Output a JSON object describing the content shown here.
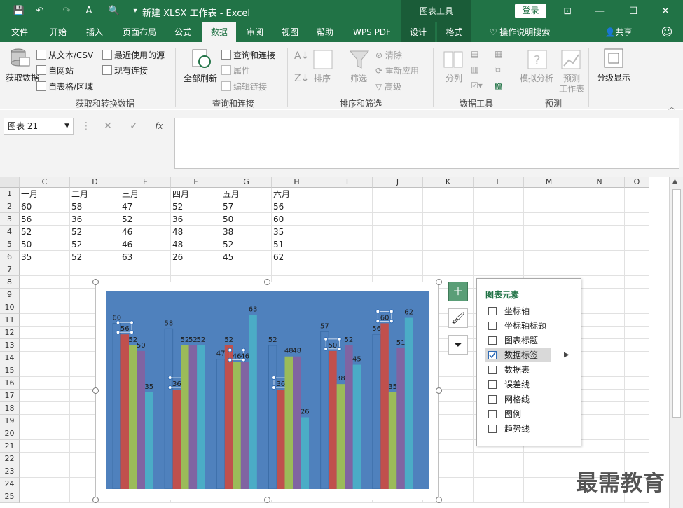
{
  "titlebar": {
    "title": "新建 XLSX 工作表 - Excel",
    "context_tab_group": "图表工具",
    "login_label": "登录"
  },
  "tabs": [
    "文件",
    "开始",
    "插入",
    "页面布局",
    "公式",
    "数据",
    "审阅",
    "视图",
    "帮助",
    "WPS PDF",
    "设计",
    "格式"
  ],
  "active_tab": "数据",
  "tell_me": "操作说明搜索",
  "share": "共享",
  "ribbon": {
    "get_data_label": "获取数据",
    "from_text_csv": "从文本/CSV",
    "from_web": "自网站",
    "from_table": "自表格/区域",
    "recent_sources": "最近使用的源",
    "existing_connections": "现有连接",
    "group_get_transform": "获取和转换数据",
    "refresh_all": "全部刷新",
    "queries_connections": "查询和连接",
    "properties": "属性",
    "edit_links": "编辑链接",
    "group_queries": "查询和连接",
    "sort": "排序",
    "filter": "筛选",
    "clear": "清除",
    "reapply": "重新应用",
    "advanced": "高级",
    "group_sort_filter": "排序和筛选",
    "text_to_columns": "分列",
    "group_data_tools": "数据工具",
    "what_if": "模拟分析",
    "forecast_sheet_line1": "预测",
    "forecast_sheet_line2": "工作表",
    "group_forecast": "预测",
    "outline": "分级显示"
  },
  "formula_bar": {
    "name_box": "图表 21",
    "fx": "fx",
    "content": ""
  },
  "columns": [
    "C",
    "D",
    "E",
    "F",
    "G",
    "H",
    "I",
    "J",
    "K",
    "L",
    "M",
    "N",
    "O"
  ],
  "rows": [
    "1",
    "2",
    "3",
    "4",
    "5",
    "6",
    "7",
    "8",
    "9",
    "10",
    "11",
    "12",
    "13",
    "14",
    "15",
    "16",
    "17",
    "18",
    "19",
    "20",
    "21",
    "22",
    "23",
    "24",
    "25"
  ],
  "table": [
    [
      "一月",
      "二月",
      "三月",
      "四月",
      "五月",
      "六月"
    ],
    [
      "60",
      "58",
      "47",
      "52",
      "57",
      "56"
    ],
    [
      "56",
      "36",
      "52",
      "36",
      "50",
      "60"
    ],
    [
      "52",
      "52",
      "46",
      "48",
      "38",
      "35"
    ],
    [
      "50",
      "52",
      "46",
      "48",
      "52",
      "51"
    ],
    [
      "35",
      "52",
      "63",
      "26",
      "45",
      "62"
    ]
  ],
  "chart_data": {
    "type": "bar",
    "categories": [
      "一月",
      "二月",
      "三月",
      "四月",
      "五月",
      "六月"
    ],
    "series": [
      {
        "values": [
          60,
          58,
          47,
          52,
          57,
          56
        ],
        "color": "#4f81bd"
      },
      {
        "values": [
          56,
          36,
          52,
          36,
          50,
          60
        ],
        "color": "#c0504d"
      },
      {
        "values": [
          52,
          52,
          46,
          48,
          38,
          35
        ],
        "color": "#9bbb59"
      },
      {
        "values": [
          50,
          52,
          46,
          48,
          52,
          51
        ],
        "color": "#8064a2"
      },
      {
        "values": [
          35,
          52,
          63,
          26,
          45,
          62
        ],
        "color": "#4bacc6"
      }
    ],
    "data_labels": true,
    "background": "#4f81bd",
    "ylim": [
      0,
      70
    ]
  },
  "chart_elements_panel": {
    "title": "图表元素",
    "items": [
      {
        "label": "坐标轴",
        "checked": false
      },
      {
        "label": "坐标轴标题",
        "checked": false
      },
      {
        "label": "图表标题",
        "checked": false
      },
      {
        "label": "数据标签",
        "checked": true
      },
      {
        "label": "数据表",
        "checked": false
      },
      {
        "label": "误差线",
        "checked": false
      },
      {
        "label": "网格线",
        "checked": false
      },
      {
        "label": "图例",
        "checked": false
      },
      {
        "label": "趋势线",
        "checked": false
      }
    ]
  },
  "watermark": "最需教育",
  "colors": {
    "excel_green": "#217346",
    "dark_green": "#1a5c38"
  }
}
